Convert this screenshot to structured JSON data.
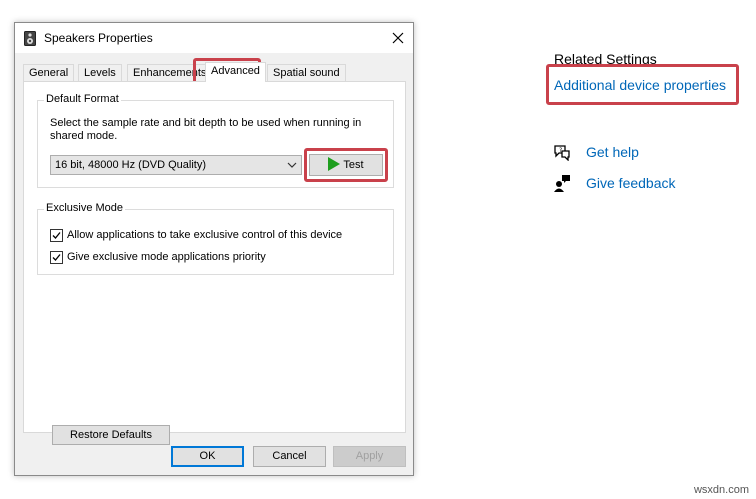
{
  "dialog": {
    "title": "Speakers Properties",
    "tabs": [
      {
        "label": "General"
      },
      {
        "label": "Levels"
      },
      {
        "label": "Enhancements"
      },
      {
        "label": "Advanced"
      },
      {
        "label": "Spatial sound"
      }
    ],
    "default_format": {
      "group_label": "Default Format",
      "description": "Select the sample rate and bit depth to be used when running in shared mode.",
      "selected_format": "16 bit, 48000 Hz (DVD Quality)",
      "test_label": "Test"
    },
    "exclusive_mode": {
      "group_label": "Exclusive Mode",
      "option1": "Allow applications to take exclusive control of this device",
      "option2": "Give exclusive mode applications priority"
    },
    "restore_label": "Restore Defaults",
    "ok_label": "OK",
    "cancel_label": "Cancel",
    "apply_label": "Apply"
  },
  "related": {
    "title": "Related Settings",
    "additional_link": "Additional device properties",
    "help_link": "Get help",
    "feedback_link": "Give feedback"
  },
  "watermark": "wsxdn.com",
  "colors": {
    "highlight": "#c9414b",
    "link": "#0067b8",
    "test_play": "#1e9e1e"
  }
}
